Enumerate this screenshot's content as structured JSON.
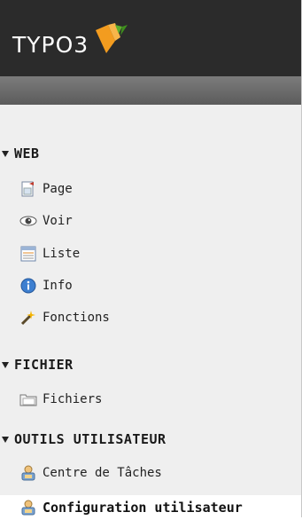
{
  "app": {
    "logo_text": "TYPO3"
  },
  "sidebar": {
    "groups": [
      {
        "label": "WEB",
        "items": [
          {
            "label": "Page",
            "icon": "page-icon"
          },
          {
            "label": "Voir",
            "icon": "eye-icon"
          },
          {
            "label": "Liste",
            "icon": "list-icon"
          },
          {
            "label": "Info",
            "icon": "info-icon"
          },
          {
            "label": "Fonctions",
            "icon": "wand-icon"
          }
        ]
      },
      {
        "label": "FICHIER",
        "items": [
          {
            "label": "Fichiers",
            "icon": "folder-icon"
          }
        ]
      },
      {
        "label": "OUTILS UTILISATEUR",
        "items": [
          {
            "label": "Centre de Tâches",
            "icon": "user-task-icon"
          },
          {
            "label": "Configuration utilisateur",
            "icon": "user-config-icon",
            "active": true
          }
        ]
      }
    ]
  },
  "colors": {
    "logo_orange": "#f39c1f",
    "logo_green": "#5cae2d",
    "top_bar": "#2b2b2b"
  }
}
